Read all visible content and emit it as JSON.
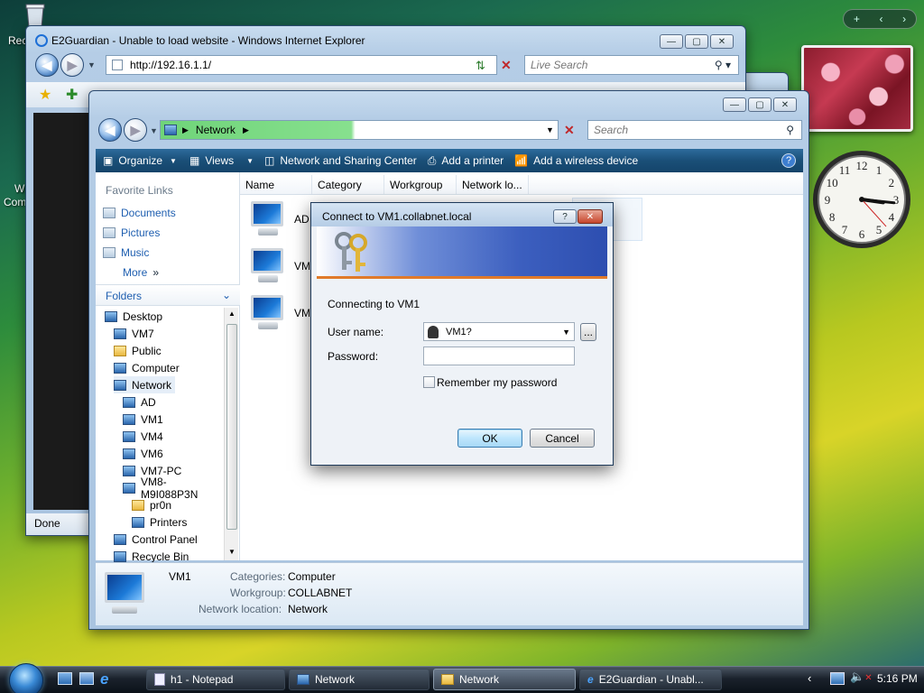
{
  "desktop": {
    "recycle_bin_label": "Rec",
    "side_label_1": "Wi",
    "side_label_2": "Com"
  },
  "ie": {
    "title": "E2Guardian - Unable to load website - Windows Internet Explorer",
    "address": "http://192.16.1.1/",
    "search_placeholder": "Live Search",
    "status": "Done"
  },
  "explorer": {
    "breadcrumb": [
      "Network"
    ],
    "search_placeholder": "Search",
    "toolbar": {
      "organize": "Organize",
      "views": "Views",
      "network_center": "Network and Sharing Center",
      "add_printer": "Add a printer",
      "add_wireless": "Add a wireless device"
    },
    "favorite_links_title": "Favorite Links",
    "favorite_links": [
      "Documents",
      "Pictures",
      "Music",
      "More"
    ],
    "folders_label": "Folders",
    "tree": [
      "Desktop",
      "VM7",
      "Public",
      "Computer",
      "Network",
      "AD",
      "VM1",
      "VM4",
      "VM6",
      "VM7-PC",
      "VM8-M9I088P3N",
      "pr0n",
      "Printers",
      "Control Panel",
      "Recycle Bin"
    ],
    "columns": [
      "Name",
      "Category",
      "Workgroup",
      "Network lo..."
    ],
    "items": [
      "AD",
      "VM4",
      "VM7"
    ],
    "details": {
      "name": "VM1",
      "categories_label": "Categories:",
      "categories_value": "Computer",
      "workgroup_label": "Workgroup:",
      "workgroup_value": "COLLABNET",
      "location_label": "Network location:",
      "location_value": "Network"
    }
  },
  "dialog": {
    "title": "Connect to VM1.collabnet.local",
    "connecting": "Connecting to VM1",
    "username_label": "User name:",
    "username_value": "VM1?",
    "password_label": "Password:",
    "remember_label": "Remember my password",
    "ok": "OK",
    "cancel": "Cancel",
    "help": "?",
    "browse": "..."
  },
  "taskbar": {
    "buttons": [
      "h1 - Notepad",
      "Network",
      "Network",
      "E2Guardian - Unabl..."
    ],
    "time": "5:16 PM"
  },
  "clock_time": {
    "hour": 3,
    "minute": 16,
    "second": 23
  }
}
